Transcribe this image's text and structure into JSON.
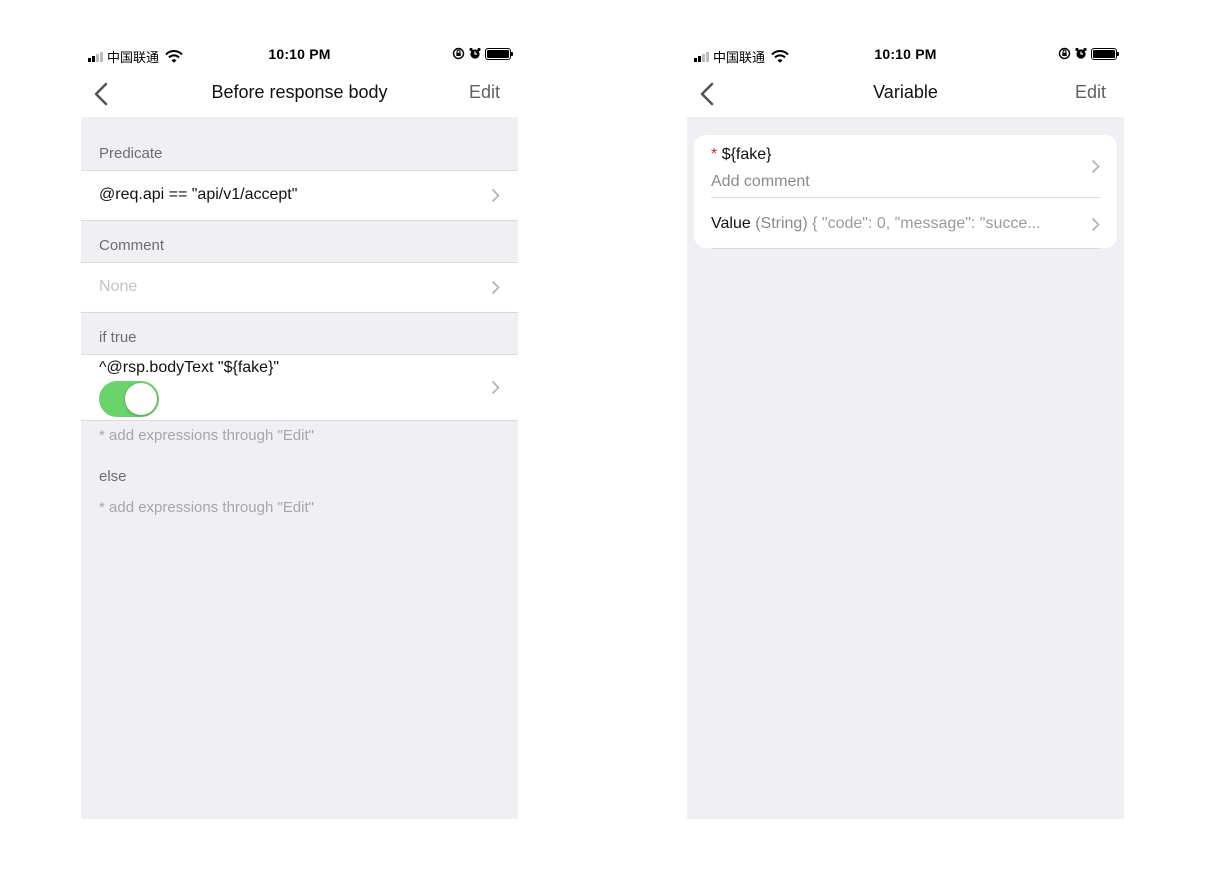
{
  "statusbar": {
    "carrier": "中国联通",
    "time": "10:10 PM"
  },
  "left_screen": {
    "nav": {
      "title": "Before response body",
      "edit_label": "Edit"
    },
    "predicate": {
      "header": "Predicate",
      "value": "@req.api == \"api/v1/accept\""
    },
    "comment": {
      "header": "Comment",
      "placeholder": "None"
    },
    "if_true": {
      "header": "if true",
      "expression": "^@rsp.bodyText \"${fake}\"",
      "toggle_on": true,
      "note": "* add expressions through \"Edit\""
    },
    "else_block": {
      "label": "else",
      "note": "* add expressions through \"Edit\""
    }
  },
  "right_screen": {
    "nav": {
      "title": "Variable",
      "edit_label": "Edit"
    },
    "variable": {
      "required_mark": "*",
      "name": "${fake}",
      "comment_placeholder": "Add comment",
      "value_label": "Value",
      "value_type": "(String)",
      "value_preview": "{  \"code\": 0,  \"message\": \"succe..."
    }
  },
  "colors": {
    "background": "#efeff4",
    "toggle_on": "#6ad36a",
    "required": "#e02020",
    "secondary_text": "#6d6d72"
  }
}
